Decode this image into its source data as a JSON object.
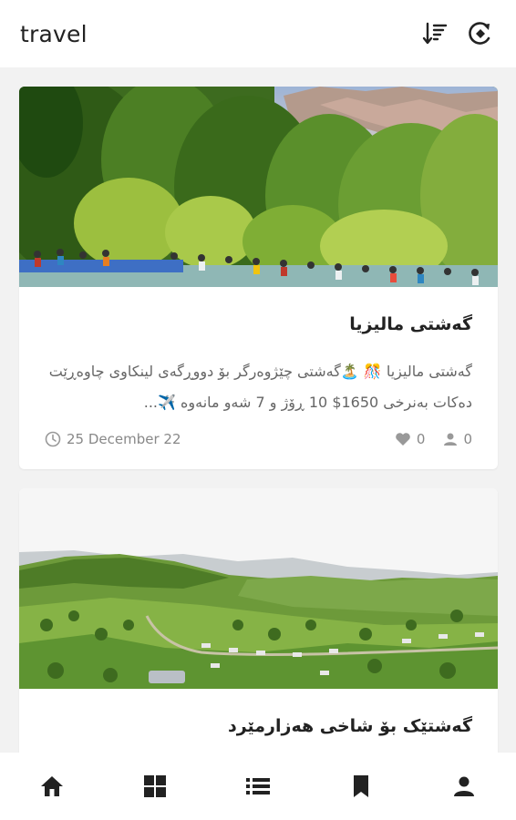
{
  "appbar": {
    "title": "travel",
    "sort_icon": "sort-icon",
    "theme_icon": "theme-toggle-icon"
  },
  "posts": [
    {
      "title": "گەشتی مالیزیا",
      "excerpt": "گەشتی مالیزیا  🎊  🏝️گەشتی چێژوەرگر بۆ دووڕگەی لینکاوی چاوەڕێت دەکات بەنرخی 1650$  10 ڕۆژ و 7 شەو مانەوە ✈️...",
      "date": "25 December 22",
      "likes": "0",
      "participants": "0",
      "image_icon": "forest-river-photo"
    },
    {
      "title": "گەشتێک بۆ شاخی هەزارمێرد",
      "image_icon": "green-valley-photo"
    }
  ],
  "bottom_nav": [
    {
      "icon": "home-icon"
    },
    {
      "icon": "grid-icon"
    },
    {
      "icon": "list-icon"
    },
    {
      "icon": "bookmark-icon"
    },
    {
      "icon": "profile-icon"
    }
  ],
  "colors": {
    "background": "#f2f2f2",
    "surface": "#ffffff",
    "icon": "#222222",
    "muted": "#888888"
  }
}
